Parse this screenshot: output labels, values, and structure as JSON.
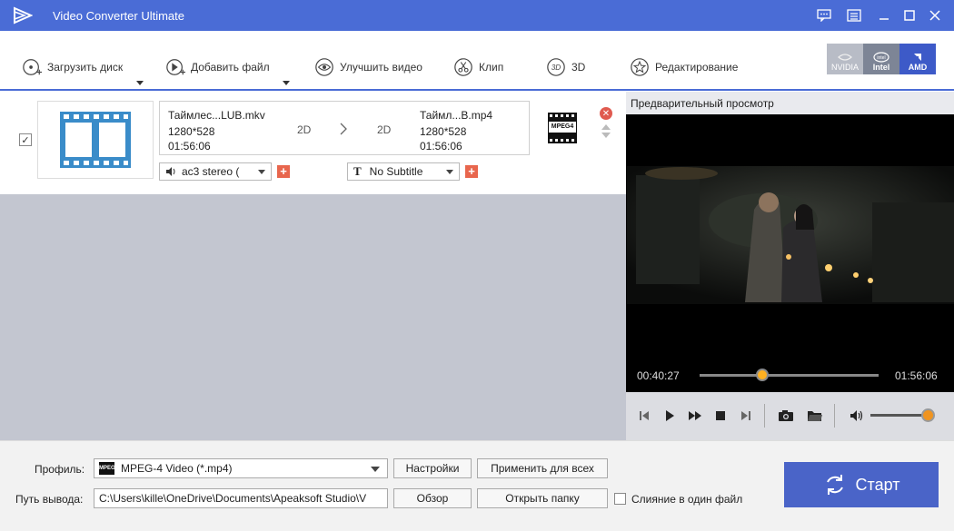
{
  "app": {
    "title": "Video Converter Ultimate"
  },
  "colors": {
    "accent": "#4a6cd6",
    "start_button": "#4a64c8",
    "close": "#e05a4f",
    "add": "#e8664d",
    "seek_knob": "#ffb020"
  },
  "toolbar": {
    "load_disc": "Загрузить диск",
    "add_file": "Добавить файл",
    "enhance": "Улучшить видео",
    "clip": "Клип",
    "three_d": "3D",
    "edit": "Редактирование",
    "gpu": [
      "NVIDIA",
      "Intel",
      "AMD"
    ]
  },
  "file": {
    "source_name": "Таймлес...LUB.mkv",
    "source_res": "1280*528",
    "source_duration": "01:56:06",
    "src_mode": "2D",
    "dst_mode": "2D",
    "output_name": "Таймл...B.mp4",
    "output_res": "1280*528",
    "output_duration": "01:56:06",
    "format_badge": "MPEG4",
    "audio_track": "ac3 stereo (",
    "subtitle": "No Subtitle"
  },
  "preview": {
    "title": "Предварительный просмотр",
    "current_time": "00:40:27",
    "total_time": "01:56:06",
    "progress": 0.35,
    "volume": 0.95
  },
  "bottom": {
    "profile_label": "Профиль:",
    "profile_value": "MPEG-4 Video (*.mp4)",
    "profile_badge": "MPEG",
    "settings_btn": "Настройки",
    "apply_all_btn": "Применить для всех",
    "output_label": "Путь вывода:",
    "output_path": "C:\\Users\\kille\\OneDrive\\Documents\\Apeaksoft Studio\\V",
    "browse_btn": "Обзор",
    "open_folder_btn": "Открыть папку",
    "merge_label": "Слияние в один файл",
    "start_btn": "Старт"
  }
}
